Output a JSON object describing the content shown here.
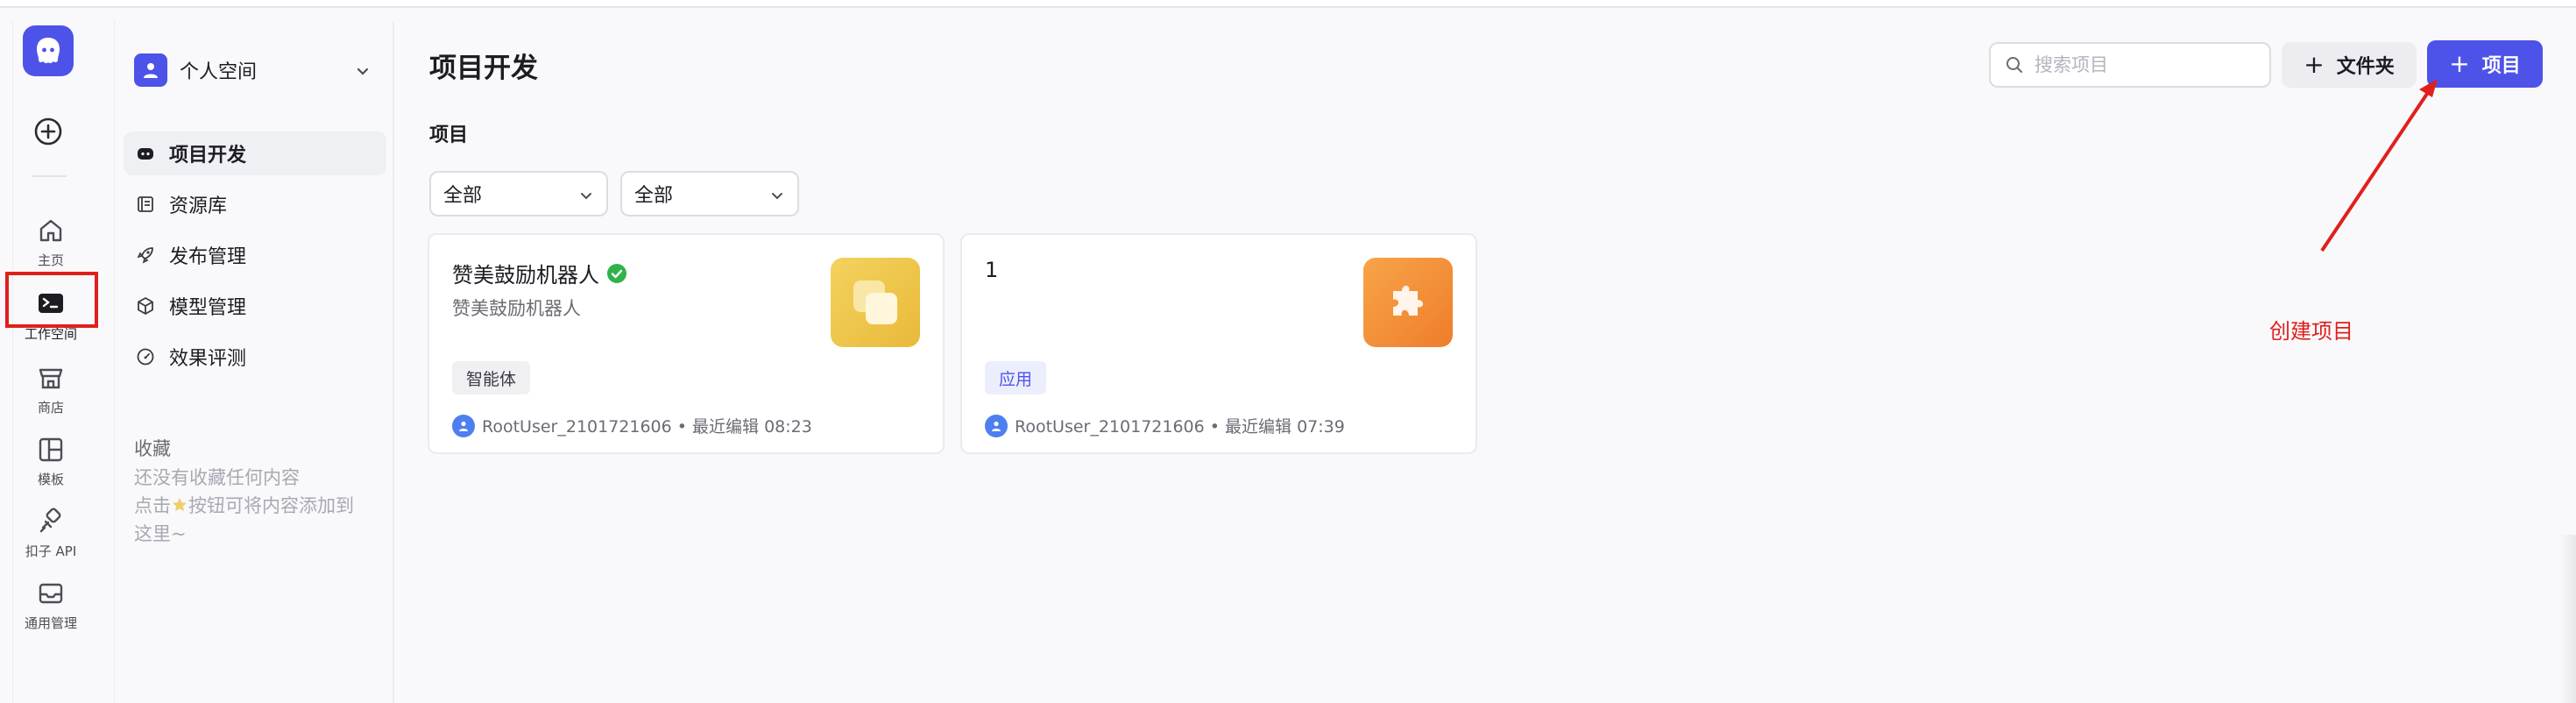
{
  "colors": {
    "brand": "#4d53e8",
    "annotation": "#e0201c",
    "verified": "#2fb34a"
  },
  "rail": {
    "items": [
      {
        "label": "主页",
        "icon": "home-icon"
      },
      {
        "label": "工作空间",
        "icon": "terminal-icon"
      },
      {
        "label": "商店",
        "icon": "store-icon"
      },
      {
        "label": "模板",
        "icon": "template-icon"
      },
      {
        "label": "扣子 API",
        "icon": "api-icon"
      },
      {
        "label": "通用管理",
        "icon": "inbox-icon"
      }
    ]
  },
  "sidebar": {
    "space_name": "个人空间",
    "nav": [
      {
        "label": "项目开发",
        "icon": "gamepad-icon"
      },
      {
        "label": "资源库",
        "icon": "library-icon"
      },
      {
        "label": "发布管理",
        "icon": "rocket-icon"
      },
      {
        "label": "模型管理",
        "icon": "cube-icon"
      },
      {
        "label": "效果评测",
        "icon": "gauge-icon"
      }
    ],
    "favorites_title": "收藏",
    "favorites_empty_line1": "还没有收藏任何内容",
    "favorites_empty_line2a": "点击",
    "favorites_empty_line2b": "按钮可将内容添加到",
    "favorites_empty_line3": "这里~"
  },
  "header": {
    "title": "项目开发",
    "search_placeholder": "搜索项目",
    "folder_button": "文件夹",
    "project_button": "项目"
  },
  "section_label": "项目",
  "filters": [
    "全部",
    "全部"
  ],
  "cards": [
    {
      "title": "赞美鼓励机器人",
      "desc": "赞美鼓励机器人",
      "tag": "智能体",
      "meta": "RootUser_2101721606 • 最近编辑 08:23",
      "verified": true
    },
    {
      "title": "1",
      "desc": "",
      "tag": "应用",
      "meta": "RootUser_2101721606 • 最近编辑 07:39",
      "verified": false
    }
  ],
  "annotation": {
    "text": "创建项目"
  }
}
